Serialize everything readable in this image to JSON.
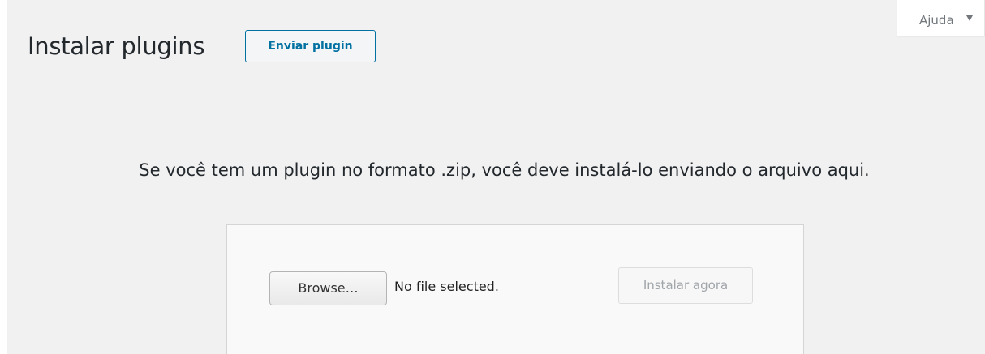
{
  "help_tab": {
    "label": "Ajuda",
    "arrow_icon": "caret-down-icon"
  },
  "header": {
    "title": "Instalar plugins",
    "upload_button_label": "Enviar plugin"
  },
  "main": {
    "upload_info": "Se você tem um plugin no formato .zip, você deve instalá-lo enviando o arquivo aqui.",
    "file_input": {
      "browse_label": "Browse…",
      "status_text": "No file selected."
    },
    "install_button_label": "Instalar agora"
  },
  "colors": {
    "accent": "#0071a1",
    "background": "#f1f1f1",
    "text": "#23282d",
    "disabled_text": "#a0a5aa"
  }
}
